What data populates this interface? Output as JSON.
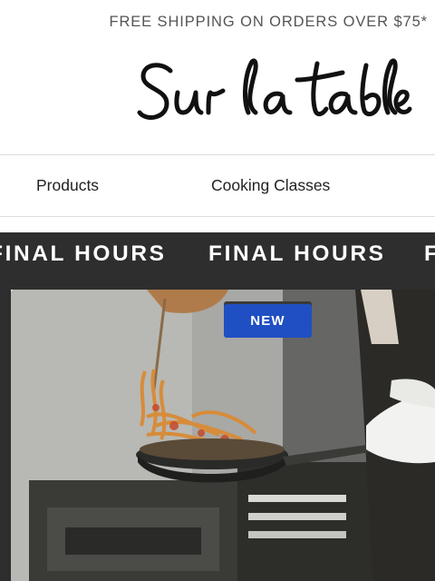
{
  "promo": {
    "text": "FREE SHIPPING ON ORDERS OVER $75*"
  },
  "logo": {
    "text": "Sur la table"
  },
  "nav": {
    "items": [
      {
        "label": "Products"
      },
      {
        "label": "Cooking Classes"
      }
    ]
  },
  "marquee": {
    "items": [
      "FINAL HOURS",
      "FINAL HOURS",
      "F"
    ],
    "background": "#2e2e2e"
  },
  "hero": {
    "badge": "NEW",
    "badge_color": "#1f4fc2",
    "image_subject": "chef-tossing-pasta-in-pan"
  }
}
